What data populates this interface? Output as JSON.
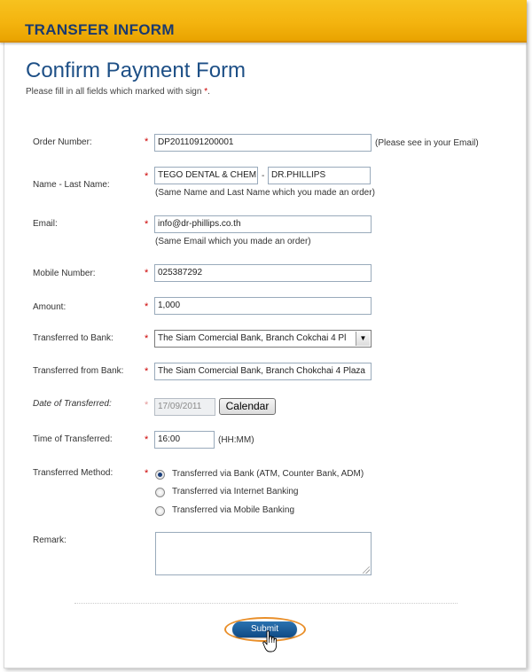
{
  "header": {
    "title": "TRANSFER INFORM"
  },
  "form": {
    "title": "Confirm Payment Form",
    "subtitle_prefix": "Please fill in all fields which marked with sign",
    "subtitle_star": "*",
    "subtitle_suffix": ".",
    "required_mark": "*"
  },
  "fields": {
    "order_number": {
      "label": "Order Number:",
      "value": "DP2011091200001",
      "hint": "(Please see in your Email)"
    },
    "name": {
      "label": "Name - Last Name:",
      "first_value": "TEGO DENTAL & CHEMI",
      "separator": "-",
      "last_value": "DR.PHILLIPS",
      "hint": "(Same Name and Last Name which you made an order)"
    },
    "email": {
      "label": "Email:",
      "value": "info@dr-phillips.co.th",
      "hint": "(Same Email which you made an order)"
    },
    "mobile": {
      "label": "Mobile Number:",
      "value": "025387292"
    },
    "amount": {
      "label": "Amount:",
      "value": "1,000"
    },
    "to_bank": {
      "label": "Transferred to Bank:",
      "value": "The Siam Comercial Bank, Branch Cokchai 4 Pl"
    },
    "from_bank": {
      "label": "Transferred from Bank:",
      "value": "The Siam Comercial Bank, Branch Chokchai 4 Plaza"
    },
    "date": {
      "label": "Date of Transferred:",
      "value": "17/09/2011",
      "button": "Calendar"
    },
    "time": {
      "label": "Time of Transferred:",
      "value": "16:00",
      "hint": "(HH:MM)"
    },
    "method": {
      "label": "Transferred Method:",
      "options": [
        {
          "label": "Transferred via Bank (ATM, Counter Bank, ADM)",
          "checked": true
        },
        {
          "label": "Transferred via Internet Banking",
          "checked": false
        },
        {
          "label": "Transferred via Mobile Banking",
          "checked": false
        }
      ]
    },
    "remark": {
      "label": "Remark:",
      "value": ""
    }
  },
  "submit": {
    "label": "Submit"
  },
  "colors": {
    "header_bg": "#f4b40f",
    "header_text": "#1b3a6e",
    "title": "#1d4f86",
    "required": "#cc0000",
    "submit_bg": "#1a5c9c",
    "highlight_ring": "#e98f2a"
  },
  "icons": {
    "select_arrow": "chevron-down-icon",
    "cursor": "hand-pointer-icon"
  }
}
